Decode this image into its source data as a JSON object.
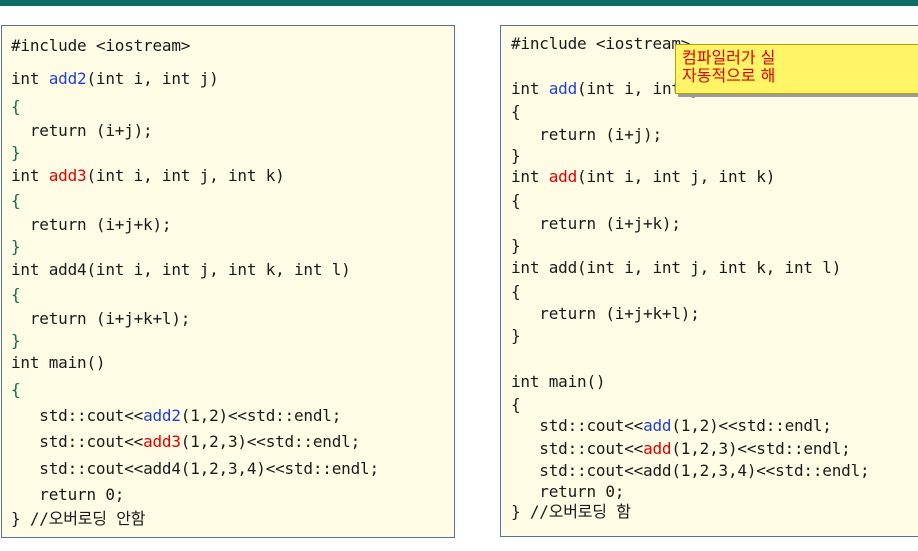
{
  "left": {
    "l1": "#include <iostream>",
    "l2a": "int ",
    "l2b": "add2",
    "l2c": "(int i, int j)",
    "l3": "{",
    "l4": "  return (i+j);",
    "l5": "}",
    "l6a": "int ",
    "l6b": "add3",
    "l6c": "(int i, int j, int k)",
    "l7": "{",
    "l8": "  return (i+j+k);",
    "l9": "}",
    "l10a": "int ",
    "l10b": "add4",
    "l10c": "(int i, int j, int k, int l)",
    "l11": "{",
    "l12": "  return (i+j+k+l);",
    "l13": "}",
    "l14": "int main()",
    "l15": "{",
    "l16a": "   std::cout<<",
    "l16b": "add2",
    "l16c": "(1,2)<<std::endl;",
    "l17a": "   std::cout<<",
    "l17b": "add3",
    "l17c": "(1,2,3)<<std::endl;",
    "l18a": "   std::cout<<",
    "l18b": "add4",
    "l18c": "(1,2,3,4)<<std::endl;",
    "l19": "   return 0;",
    "l20a": "} ",
    "l20b": "//오버로딩 안함"
  },
  "right": {
    "l1": "#include <iostream>",
    "l2a": "int ",
    "l2b": "add",
    "l2c": "(int i, int j)",
    "l3": "{",
    "l4": "   return (i+j);",
    "l5": "}",
    "l6a": "int ",
    "l6b": "add",
    "l6c": "(int i, int j, int k)",
    "l7": "{",
    "l8": "   return (i+j+k);",
    "l9": "}",
    "l10": "int add(int i, int j, int k, int l)",
    "l11": "{",
    "l12": "   return (i+j+k+l);",
    "l13": "}",
    "l14": "int main()",
    "l15": "{",
    "l16a": "   std::cout<<",
    "l16b": "add",
    "l16c": "(1,2)<<std::endl;",
    "l17a": "   std::cout<<",
    "l17b": "add",
    "l17c": "(1,2,3)<<std::endl;",
    "l18": "   std::cout<<add(1,2,3,4)<<std::endl;",
    "l19": "   return 0;",
    "l20a": "} ",
    "l20b": "//오버로딩 함"
  },
  "note": {
    "line1": "컴파일러가 실",
    "line2": "자동적으로 해"
  }
}
